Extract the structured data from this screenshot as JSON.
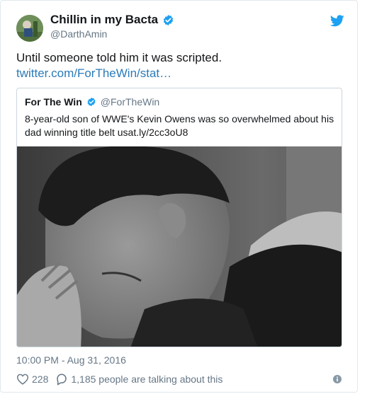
{
  "author": {
    "name": "Chillin in my Bacta",
    "handle": "@DarthAmin"
  },
  "tweet": {
    "text": "Until someone told him it was scripted.",
    "link": "twitter.com/ForTheWin/stat…"
  },
  "quoted": {
    "name": "For The Win",
    "handle": "@ForTheWin",
    "text": "8-year-old son of WWE's Kevin Owens was so overwhelmed about his dad winning title belt usat.ly/2cc3oU8"
  },
  "timestamp": "10:00 PM - Aug 31, 2016",
  "actions": {
    "likes": "228",
    "replies": "1,185 people are talking about this"
  },
  "icons": {
    "verified": "verified-badge-icon",
    "bird": "twitter-bird-icon",
    "heart": "heart-icon",
    "reply": "speech-bubble-icon",
    "info": "info-icon"
  },
  "colors": {
    "brand": "#1da1f2",
    "link": "#2b7bb9",
    "secondary_text": "#657786"
  }
}
